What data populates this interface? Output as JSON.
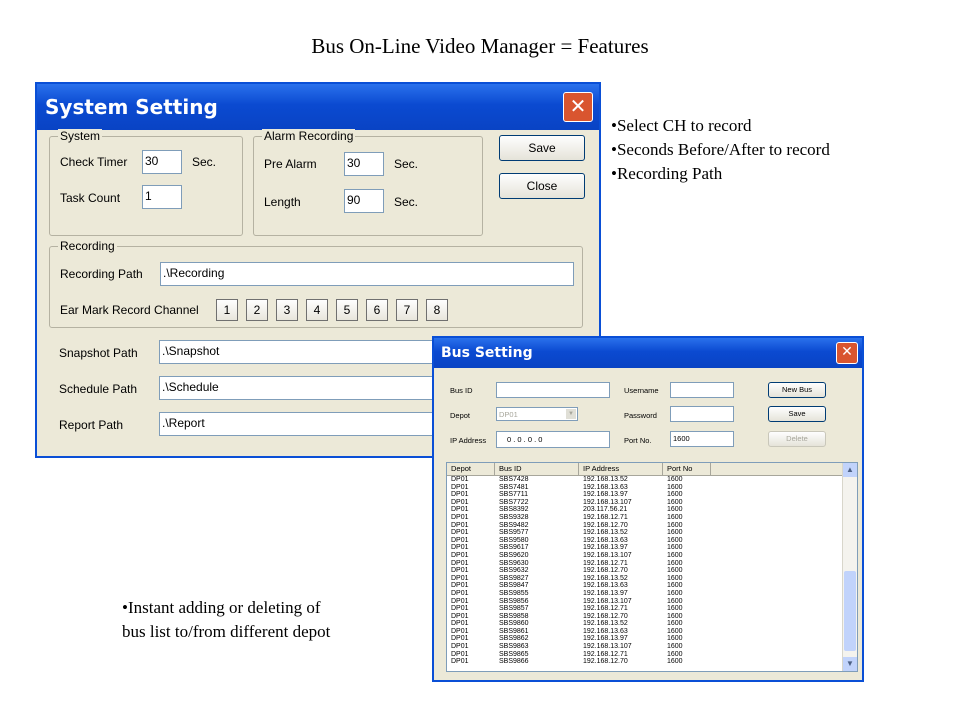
{
  "slide": {
    "title": "Bus On-Line Video Manager  =  Features",
    "bullets_top": [
      "•Select CH to record",
      "•Seconds Before/After to record",
      "•Recording Path"
    ],
    "bullets_bottom": [
      "•Instant adding or deleting of",
      "bus list to/from different depot"
    ]
  },
  "system_setting": {
    "title": "System Setting",
    "close_glyph": "✕",
    "system_group": {
      "label": "System",
      "check_timer_label": "Check Timer",
      "check_timer_value": "30",
      "check_timer_unit": "Sec.",
      "task_count_label": "Task Count",
      "task_count_value": "1"
    },
    "alarm_group": {
      "label": "Alarm Recording",
      "pre_alarm_label": "Pre Alarm",
      "pre_alarm_value": "30",
      "pre_alarm_unit": "Sec.",
      "length_label": "Length",
      "length_value": "90",
      "length_unit": "Sec."
    },
    "save_label": "Save",
    "close_label": "Close",
    "recording_group": {
      "label": "Recording",
      "path_label": "Recording Path",
      "path_value": ".\\Recording",
      "ear_mark_label": "Ear Mark Record Channel",
      "channels": [
        "1",
        "2",
        "3",
        "4",
        "5",
        "6",
        "7",
        "8"
      ]
    },
    "snapshot_label": "Snapshot Path",
    "snapshot_value": ".\\Snapshot",
    "schedule_label": "Schedule Path",
    "schedule_value": ".\\Schedule",
    "report_label": "Report Path",
    "report_value": ".\\Report"
  },
  "bus_setting": {
    "title": "Bus Setting",
    "close_glyph": "✕",
    "bus_id_label": "Bus ID",
    "bus_id_value": "",
    "depot_label": "Depot",
    "depot_value": "DP01",
    "ip_label": "IP Address",
    "ip_value": "0  .  0  .  0  .  0",
    "username_label": "Username",
    "username_value": "",
    "password_label": "Password",
    "password_value": "",
    "port_label": "Port No.",
    "port_value": "1600",
    "new_bus_label": "New Bus",
    "save_label": "Save",
    "delete_label": "Delete",
    "columns": [
      "Depot",
      "Bus ID",
      "IP Address",
      "Port No"
    ],
    "rows": [
      [
        "DP01",
        "SBS7428",
        "192.168.13.52",
        "1600"
      ],
      [
        "DP01",
        "SBS7481",
        "192.168.13.63",
        "1600"
      ],
      [
        "DP01",
        "SBS7711",
        "192.168.13.97",
        "1600"
      ],
      [
        "DP01",
        "SBS7722",
        "192.168.13.107",
        "1600"
      ],
      [
        "DP01",
        "SBS8392",
        "203.117.56.21",
        "1600"
      ],
      [
        "DP01",
        "SBS9328",
        "192.168.12.71",
        "1600"
      ],
      [
        "DP01",
        "SBS9482",
        "192.168.12.70",
        "1600"
      ],
      [
        "DP01",
        "SBS9577",
        "192.168.13.52",
        "1600"
      ],
      [
        "DP01",
        "SBS9580",
        "192.168.13.63",
        "1600"
      ],
      [
        "DP01",
        "SBS9617",
        "192.168.13.97",
        "1600"
      ],
      [
        "DP01",
        "SBS9620",
        "192.168.13.107",
        "1600"
      ],
      [
        "DP01",
        "SBS9630",
        "192.168.12.71",
        "1600"
      ],
      [
        "DP01",
        "SBS9632",
        "192.168.12.70",
        "1600"
      ],
      [
        "DP01",
        "SBS9827",
        "192.168.13.52",
        "1600"
      ],
      [
        "DP01",
        "SBS9847",
        "192.168.13.63",
        "1600"
      ],
      [
        "DP01",
        "SBS9855",
        "192.168.13.97",
        "1600"
      ],
      [
        "DP01",
        "SBS9856",
        "192.168.13.107",
        "1600"
      ],
      [
        "DP01",
        "SBS9857",
        "192.168.12.71",
        "1600"
      ],
      [
        "DP01",
        "SBS9858",
        "192.168.12.70",
        "1600"
      ],
      [
        "DP01",
        "SBS9860",
        "192.168.13.52",
        "1600"
      ],
      [
        "DP01",
        "SBS9861",
        "192.168.13.63",
        "1600"
      ],
      [
        "DP01",
        "SBS9862",
        "192.168.13.97",
        "1600"
      ],
      [
        "DP01",
        "SBS9863",
        "192.168.13.107",
        "1600"
      ],
      [
        "DP01",
        "SBS9865",
        "192.168.12.71",
        "1600"
      ],
      [
        "DP01",
        "SBS9866",
        "192.168.12.70",
        "1600"
      ]
    ]
  }
}
